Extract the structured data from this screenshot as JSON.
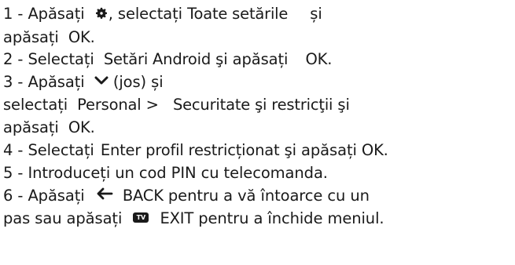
{
  "lines": [
    {
      "prefix": "1 -  Apăsați",
      "icon": "gear-icon",
      "text_a": ", selectați",
      "bold_a": "Toate setările",
      "text_b": "și"
    },
    {
      "text": "apăsați",
      "bold": "OK",
      "suffix": "."
    },
    {
      "prefix": "2 -  Selectați",
      "bold_a": "Setări Android",
      "text_a": "şi apăsați",
      "bold_b": "OK",
      "suffix": "."
    },
    {
      "prefix": "3 -  Apăsați",
      "icon": "chevron-down-icon",
      "text": "(jos) și"
    },
    {
      "prefix": "selectați",
      "bold_a": "Personal",
      "sep": ">",
      "bold_b": "Securitate şi restricţii",
      "text": "şi"
    },
    {
      "text": "apăsați",
      "bold": "OK",
      "suffix": "."
    },
    {
      "prefix": "4 -  Selectați",
      "bold_a": "Enter profil restricționat",
      "text_a": "şi apăsați",
      "bold_b": "OK",
      "suffix": "."
    },
    {
      "text": "5 -  Introduceți un cod PIN cu telecomanda."
    },
    {
      "prefix": "6 -  Apăsați",
      "icon": "back-arrow-icon",
      "bold": "BACK",
      "text": "pentru a vă întoarce cu un"
    },
    {
      "prefix": "pas sau apăsați",
      "icon_label": "TV",
      "bold": "EXIT",
      "text": "pentru a închide meniul."
    }
  ]
}
